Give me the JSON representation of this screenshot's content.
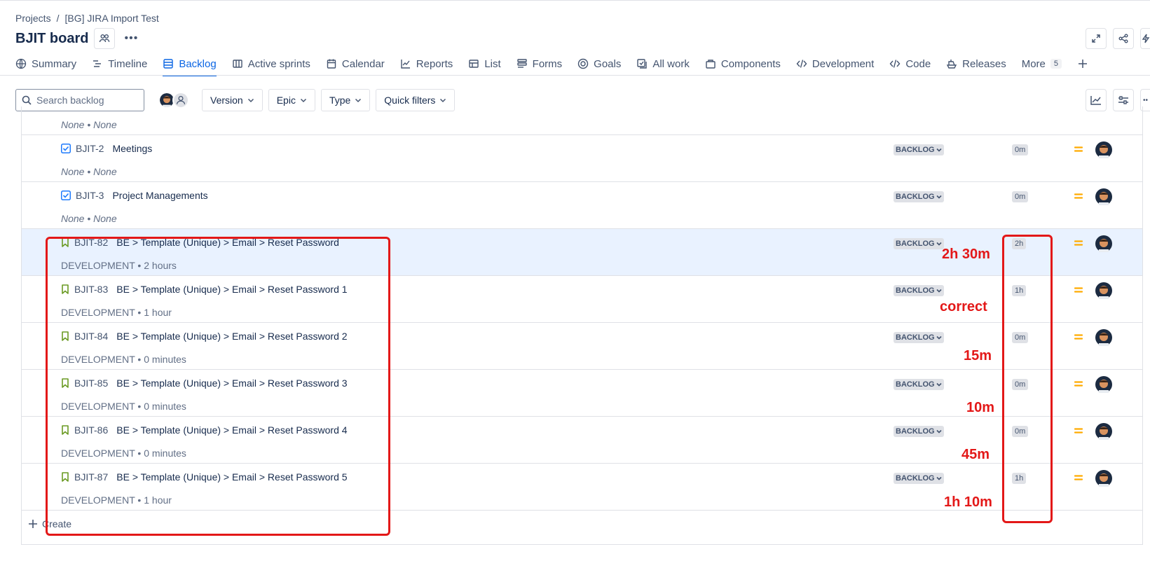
{
  "breadcrumb": {
    "projects": "Projects",
    "separator": "/",
    "project": "[BG] JIRA Import Test"
  },
  "board": {
    "title": "BJIT board"
  },
  "tabs": [
    {
      "label": "Summary",
      "icon": "globe-icon"
    },
    {
      "label": "Timeline",
      "icon": "timeline-icon"
    },
    {
      "label": "Backlog",
      "icon": "backlog-icon",
      "active": true
    },
    {
      "label": "Active sprints",
      "icon": "columns-icon"
    },
    {
      "label": "Calendar",
      "icon": "calendar-icon"
    },
    {
      "label": "Reports",
      "icon": "chart-line-icon"
    },
    {
      "label": "List",
      "icon": "table-icon"
    },
    {
      "label": "Forms",
      "icon": "forms-icon"
    },
    {
      "label": "Goals",
      "icon": "target-icon"
    },
    {
      "label": "All work",
      "icon": "all-work-icon"
    },
    {
      "label": "Components",
      "icon": "components-icon"
    },
    {
      "label": "Development",
      "icon": "code-icon"
    },
    {
      "label": "Code",
      "icon": "code-slash-icon"
    },
    {
      "label": "Releases",
      "icon": "ship-icon"
    },
    {
      "label": "More",
      "count": "5"
    }
  ],
  "toolbar": {
    "search_placeholder": "Search backlog",
    "filters": [
      "Version",
      "Epic",
      "Type",
      "Quick filters"
    ]
  },
  "issues": [
    {
      "key": "",
      "summary": "",
      "type": "task",
      "sub": "None • None",
      "status": "",
      "estimate": "",
      "partial": true
    },
    {
      "key": "BJIT-2",
      "summary": "Meetings",
      "type": "task",
      "sub": "None • None",
      "status": "BACKLOG",
      "estimate": "0m"
    },
    {
      "key": "BJIT-3",
      "summary": "Project Managements",
      "type": "task",
      "sub": "None • None",
      "status": "BACKLOG",
      "estimate": "0m"
    },
    {
      "key": "BJIT-82",
      "summary": "BE > Template (Unique) > Email > Reset Password",
      "type": "story",
      "sub": "DEVELOPMENT • 2 hours",
      "status": "BACKLOG",
      "estimate": "2h",
      "highlight": true
    },
    {
      "key": "BJIT-83",
      "summary": "BE > Template (Unique) > Email > Reset Password 1",
      "type": "story",
      "sub": "DEVELOPMENT • 1 hour",
      "status": "BACKLOG",
      "estimate": "1h"
    },
    {
      "key": "BJIT-84",
      "summary": "BE > Template (Unique) > Email > Reset Password 2",
      "type": "story",
      "sub": "DEVELOPMENT • 0 minutes",
      "status": "BACKLOG",
      "estimate": "0m"
    },
    {
      "key": "BJIT-85",
      "summary": "BE > Template (Unique) > Email > Reset Password 3",
      "type": "story",
      "sub": "DEVELOPMENT • 0 minutes",
      "status": "BACKLOG",
      "estimate": "0m"
    },
    {
      "key": "BJIT-86",
      "summary": "BE > Template (Unique) > Email > Reset Password 4",
      "type": "story",
      "sub": "DEVELOPMENT • 0 minutes",
      "status": "BACKLOG",
      "estimate": "0m"
    },
    {
      "key": "BJIT-87",
      "summary": "BE > Template (Unique) > Email > Reset Password 5",
      "type": "story",
      "sub": "DEVELOPMENT • 1 hour",
      "status": "BACKLOG",
      "estimate": "1h"
    }
  ],
  "annotations": [
    "2h 30m",
    "correct",
    "15m",
    "10m",
    "45m",
    "1h 10m"
  ],
  "create_label": "Create",
  "colors": {
    "accent": "#0c66e4",
    "annotation": "#e31818",
    "priority": "#ffab00",
    "story": "#6a9a23",
    "task": "#1d7afc"
  }
}
